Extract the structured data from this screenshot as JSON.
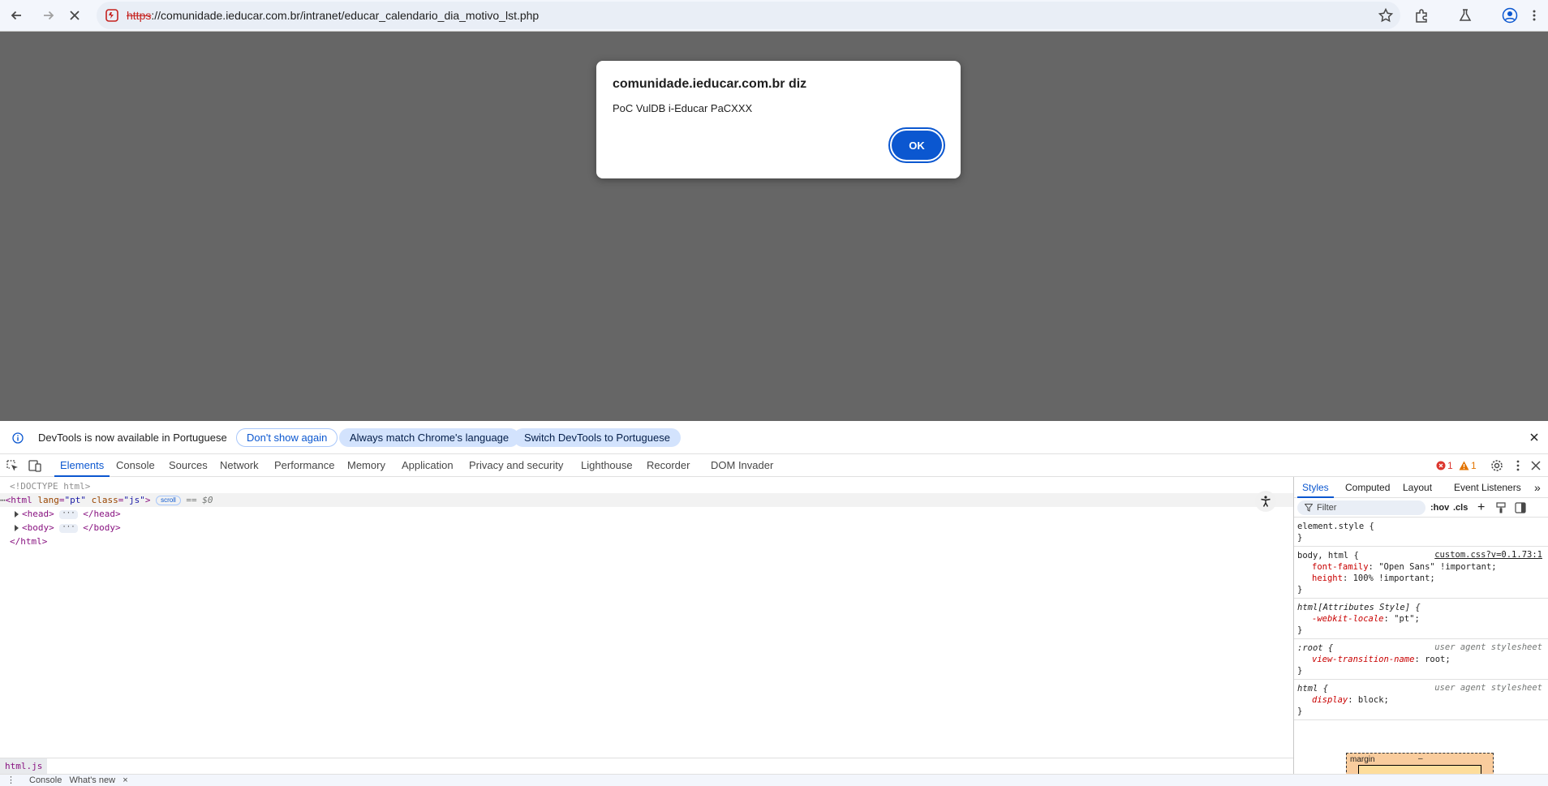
{
  "browser": {
    "url_scheme": "https",
    "url_rest": "://comunidade.ieducar.com.br/intranet/educar_calendario_dia_motivo_lst.php"
  },
  "dialog": {
    "title": "comunidade.ieducar.com.br diz",
    "message": "PoC VulDB i-Educar PaCXXX",
    "ok_label": "OK"
  },
  "infobar": {
    "message": "DevTools is now available in Portuguese",
    "dont_show": "Don't show again",
    "always_match": "Always match Chrome's language",
    "switch": "Switch DevTools to Portuguese"
  },
  "devtools": {
    "tabs": [
      "Elements",
      "Console",
      "Sources",
      "Network",
      "Performance",
      "Memory",
      "Application",
      "Privacy and security",
      "Lighthouse",
      "Recorder",
      "DOM Invader"
    ],
    "errors": "1",
    "warnings": "1"
  },
  "elements": {
    "doctype": "<!DOCTYPE html>",
    "html_open_tag": "html",
    "html_attr1_name": "lang",
    "html_attr1_val": "\"pt\"",
    "html_attr2_name": "class",
    "html_attr2_val": "\"js\"",
    "scroll_badge": "scroll",
    "dollar": "== $0",
    "head_open": "<head>",
    "head_close": "</head>",
    "body_open": "<body>",
    "body_close": "</body>",
    "html_close": "</html>",
    "ellipsis": "···",
    "breadcrumb": "html.js"
  },
  "styles": {
    "tabs": [
      "Styles",
      "Computed",
      "Layout",
      "Event Listeners"
    ],
    "filter_placeholder": "Filter",
    "hov": ":hov",
    "cls": ".cls",
    "rules": {
      "element_style": "element.style {",
      "close": "}",
      "r1_selector": "body, html {",
      "r1_source": "custom.css?v=0.1.73:1",
      "r1_p1_name": "font-family",
      "r1_p1_val": "\"Open Sans\" !important;",
      "r1_p2_name": "height",
      "r1_p2_val": "100% !important;",
      "r2_selector": "html[Attributes Style] {",
      "r2_p1_name": "-webkit-locale",
      "r2_p1_val": "\"pt\";",
      "r3_selector": ":root {",
      "r3_source": "user agent stylesheet",
      "r3_p1_name": "view-transition-name",
      "r3_p1_val": "root;",
      "r4_selector": "html {",
      "r4_source": "user agent stylesheet",
      "r4_p1_name": "display",
      "r4_p1_val": "block;"
    },
    "boxmodel_label": "margin",
    "boxmodel_dash": "–"
  },
  "drawer": {
    "text": "Console   What's new   ×"
  }
}
